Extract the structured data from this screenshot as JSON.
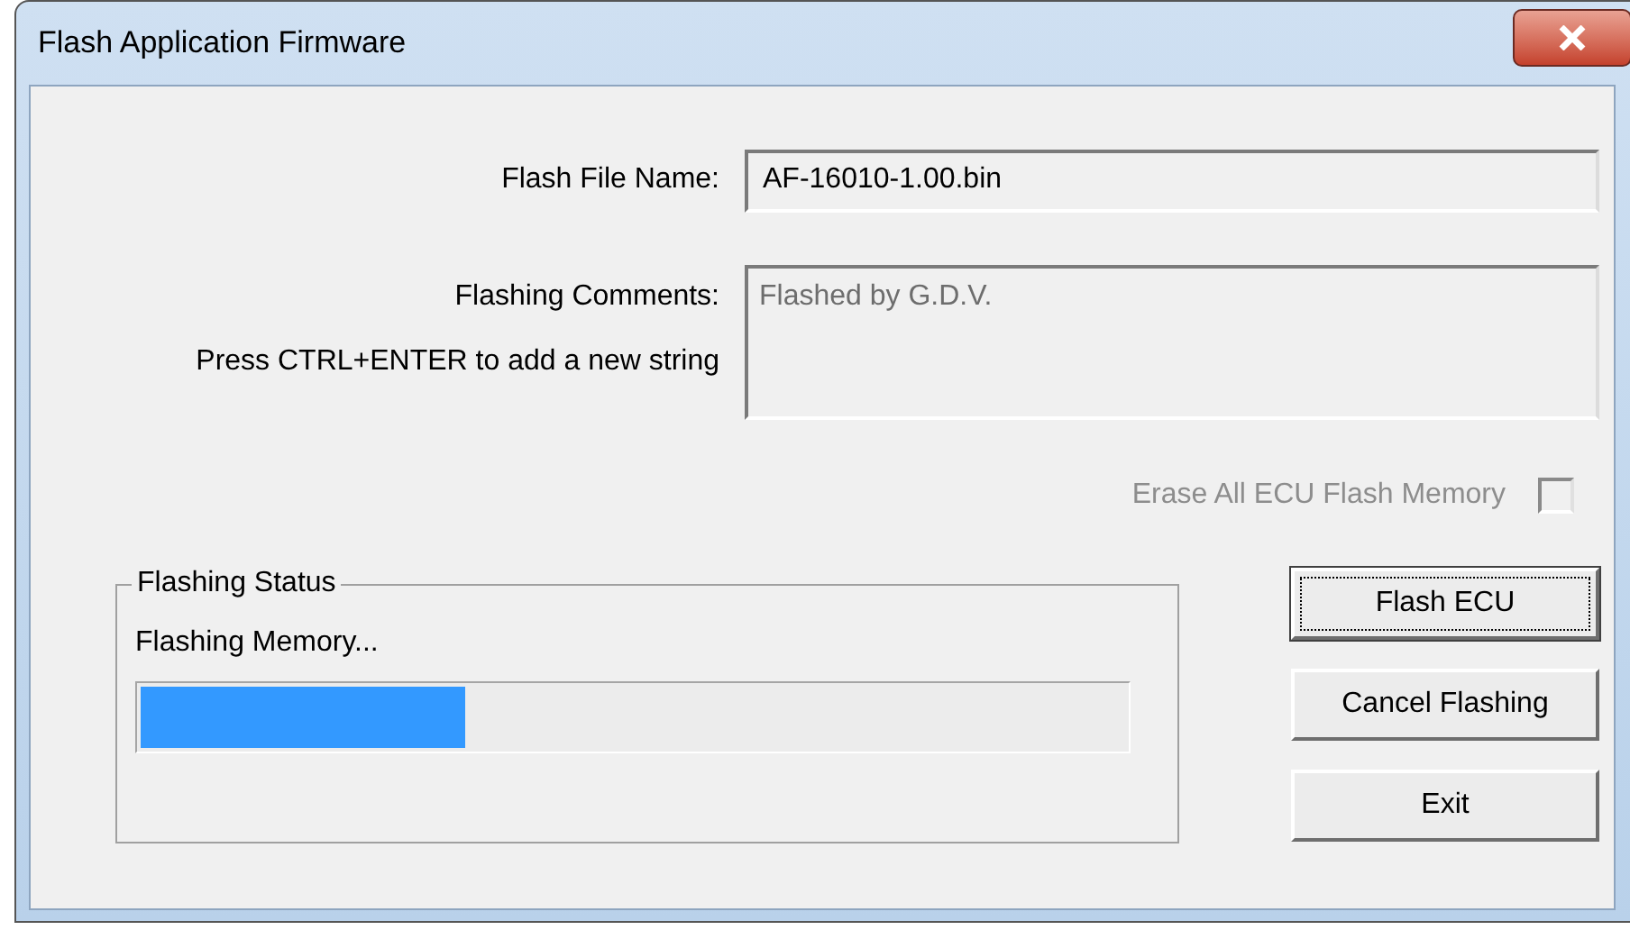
{
  "window": {
    "title": "Flash Application Firmware"
  },
  "file_name": {
    "label": "Flash File Name:",
    "value": "AF-16010-1.00.bin"
  },
  "comments": {
    "label": "Flashing Comments:",
    "hint": "Press CTRL+ENTER to add a new string",
    "value": "Flashed by G.D.V."
  },
  "erase_checkbox": {
    "label": "Erase All ECU Flash Memory",
    "checked": false,
    "disabled": true
  },
  "status_group": {
    "title": "Flashing Status",
    "message": "Flashing Memory...",
    "progress": {
      "level": 0.33
    }
  },
  "buttons": [
    {
      "label": "Flash ECU",
      "focused": true
    },
    {
      "label": "Cancel Flashing",
      "focused": false
    },
    {
      "label": "Exit",
      "focused": false
    }
  ]
}
